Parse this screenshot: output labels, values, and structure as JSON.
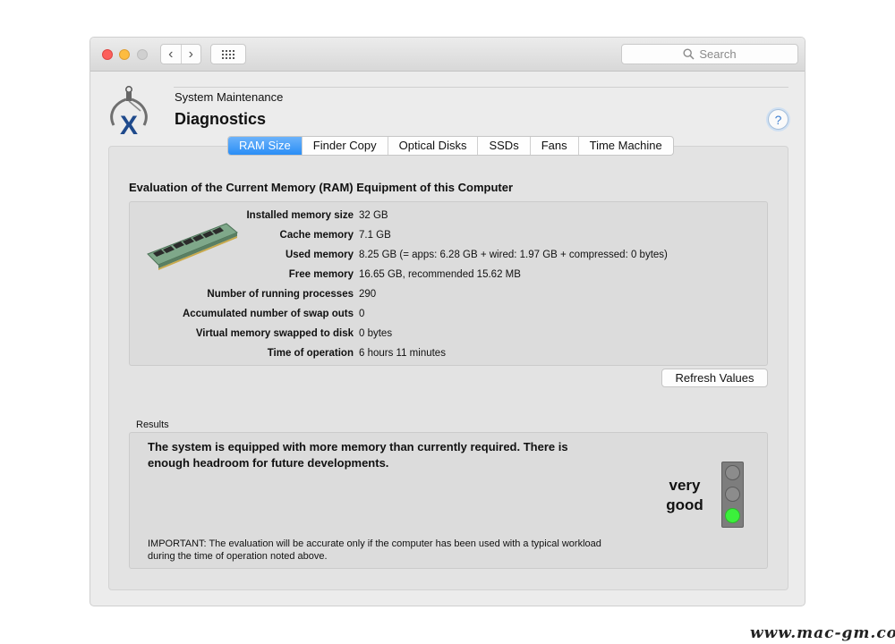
{
  "toolbar": {
    "back_glyph": "‹",
    "forward_glyph": "›",
    "search_placeholder": "Search"
  },
  "header": {
    "subtitle": "System Maintenance",
    "title": "Diagnostics",
    "help_glyph": "?"
  },
  "tabs": [
    {
      "label": "RAM Size",
      "active": true
    },
    {
      "label": "Finder Copy",
      "active": false
    },
    {
      "label": "Optical Disks",
      "active": false
    },
    {
      "label": "SSDs",
      "active": false
    },
    {
      "label": "Fans",
      "active": false
    },
    {
      "label": "Time Machine",
      "active": false
    }
  ],
  "main": {
    "section_title": "Evaluation of the Current Memory (RAM) Equipment of this Computer",
    "info": [
      {
        "label": "Installed memory size",
        "value": "32 GB"
      },
      {
        "label": "Cache memory",
        "value": "7.1 GB"
      },
      {
        "label": "Used memory",
        "value": "8.25 GB (= apps: 6.28 GB + wired: 1.97 GB + compressed: 0 bytes)"
      },
      {
        "label": "Free memory",
        "value": "16.65 GB, recommended 15.62 MB"
      },
      {
        "label": "Number of running processes",
        "value": "290"
      },
      {
        "label": "Accumulated number of swap outs",
        "value": "0"
      },
      {
        "label": "Virtual memory swapped to disk",
        "value": "0 bytes"
      },
      {
        "label": "Time of operation",
        "value": "6 hours 11 minutes"
      }
    ],
    "refresh_label": "Refresh Values"
  },
  "results": {
    "label": "Results",
    "text": "The system is equipped with more memory than currently required. There is enough headroom for future developments.",
    "verdict": "very good",
    "traffic_light_state": "green",
    "note": "IMPORTANT: The evaluation will be accurate only if the computer has been used with a typical workload during the time of operation noted above."
  },
  "colors": {
    "accent": "#2a8ef6",
    "status_green": "#3bf03b",
    "close": "#fc605c",
    "minimize": "#fdbc40"
  },
  "icons": {
    "logo": "calipers-x-icon",
    "ram": "ram-module-icon",
    "search": "magnifier-icon",
    "grid": "grid-icon"
  },
  "watermark": "www.mac-gm.com"
}
